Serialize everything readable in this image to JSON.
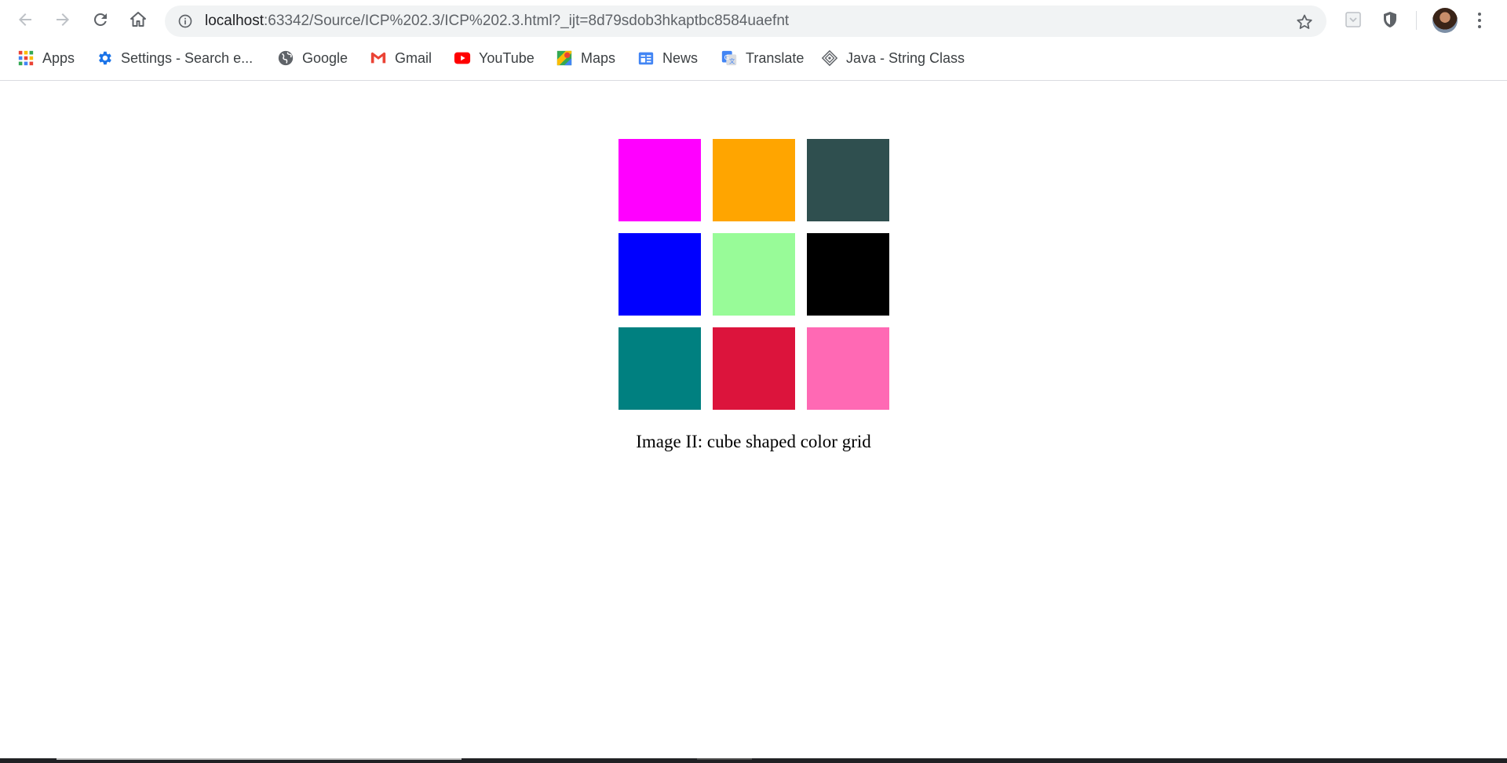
{
  "toolbar": {
    "url_host": "localhost",
    "url_path": ":63342/Source/ICP%202.3/ICP%202.3.html?_ijt=8d79sdob3hkaptbc8584uaefnt"
  },
  "bookmarks": [
    {
      "label": "Apps",
      "icon": "apps-grid-icon"
    },
    {
      "label": "Settings - Search e...",
      "icon": "settings-gear-icon"
    },
    {
      "label": "Google",
      "icon": "globe-icon"
    },
    {
      "label": "Gmail",
      "icon": "gmail-icon"
    },
    {
      "label": "YouTube",
      "icon": "youtube-icon"
    },
    {
      "label": "Maps",
      "icon": "maps-icon"
    },
    {
      "label": "News",
      "icon": "news-icon"
    },
    {
      "label": "Translate",
      "icon": "translate-icon"
    },
    {
      "label": "Java - String Class",
      "icon": "java-icon"
    }
  ],
  "grid": {
    "colors": [
      "#ff00ff",
      "#ffa500",
      "#2f4f4f",
      "#0000ff",
      "#98fb98",
      "#000000",
      "#008080",
      "#dc143c",
      "#ff69b4"
    ]
  },
  "caption": "Image II: cube shaped color grid"
}
